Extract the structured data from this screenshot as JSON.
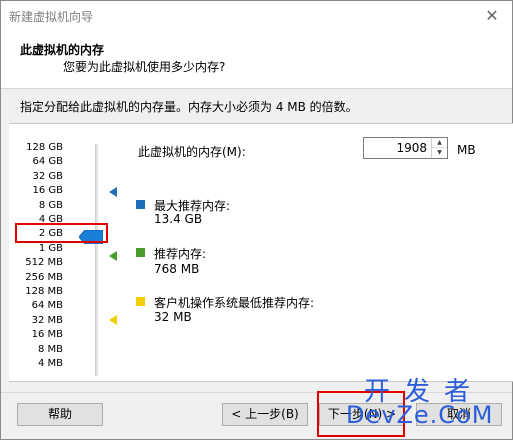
{
  "window": {
    "title": "新建虚拟机向导",
    "close_glyph": "✕"
  },
  "header": {
    "title": "此虚拟机的内存",
    "subtitle": "您要为此虚拟机使用多少内存?"
  },
  "description": "指定分配给此虚拟机的内存量。内存大小必须为 4 MB 的倍数。",
  "scale": {
    "labels": [
      "128 GB",
      "64 GB",
      "32 GB",
      "16 GB",
      "8 GB",
      "4 GB",
      "2 GB",
      "1 GB",
      "512 MB",
      "256 MB",
      "128 MB",
      "64 MB",
      "32 MB",
      "16 MB",
      "8 MB",
      "4 MB"
    ],
    "selected": "2 GB"
  },
  "memory": {
    "label": "此虚拟机的内存(M):",
    "value": "1908",
    "unit": "MB"
  },
  "legend": {
    "max": {
      "title": "最大推荐内存:",
      "value": "13.4 GB",
      "color": "#1f6fb8"
    },
    "recommended": {
      "title": "推荐内存:",
      "value": "768 MB",
      "color": "#4a9d2a"
    },
    "min": {
      "title": "客户机操作系统最低推荐内存:",
      "value": "32 MB",
      "color": "#f0d000"
    }
  },
  "buttons": {
    "help": "帮助",
    "back": "< 上一步(B)",
    "next": "下一步(N) >",
    "cancel": "取消"
  },
  "watermark": {
    "top": "开发者",
    "bottom": "DevZe.CoM"
  }
}
